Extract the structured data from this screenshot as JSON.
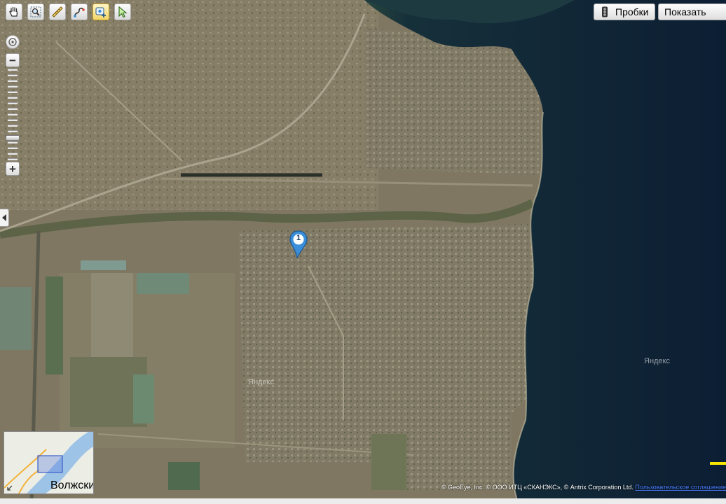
{
  "toolbar": {
    "tools": [
      {
        "icon": "hand-icon",
        "active": false
      },
      {
        "icon": "magnifier-icon",
        "active": false
      },
      {
        "icon": "ruler-icon",
        "active": false
      },
      {
        "icon": "route-icon",
        "active": false
      },
      {
        "icon": "add-point-icon",
        "active": true
      },
      {
        "icon": "select-arrow-icon",
        "active": false
      }
    ],
    "traffic_label": "Пробки",
    "show_label": "Показать"
  },
  "zoom": {
    "minus": "−",
    "plus": "+"
  },
  "marker": {
    "number": "1"
  },
  "watermarks": {
    "land": "Яндекс",
    "water": "Яндекс"
  },
  "minimap": {
    "city_label": "Волжски"
  },
  "copyright": {
    "text": "© GeoEye, Inc. © ООО ИТЦ «СКАНЭКС», © Antrix Corporation Ltd.",
    "link": "Пользовательское соглашение"
  },
  "colors": {
    "water": "#0e2238",
    "land": "#7d7560",
    "marker": "#3a8fd8",
    "scale": "#f7e600"
  }
}
